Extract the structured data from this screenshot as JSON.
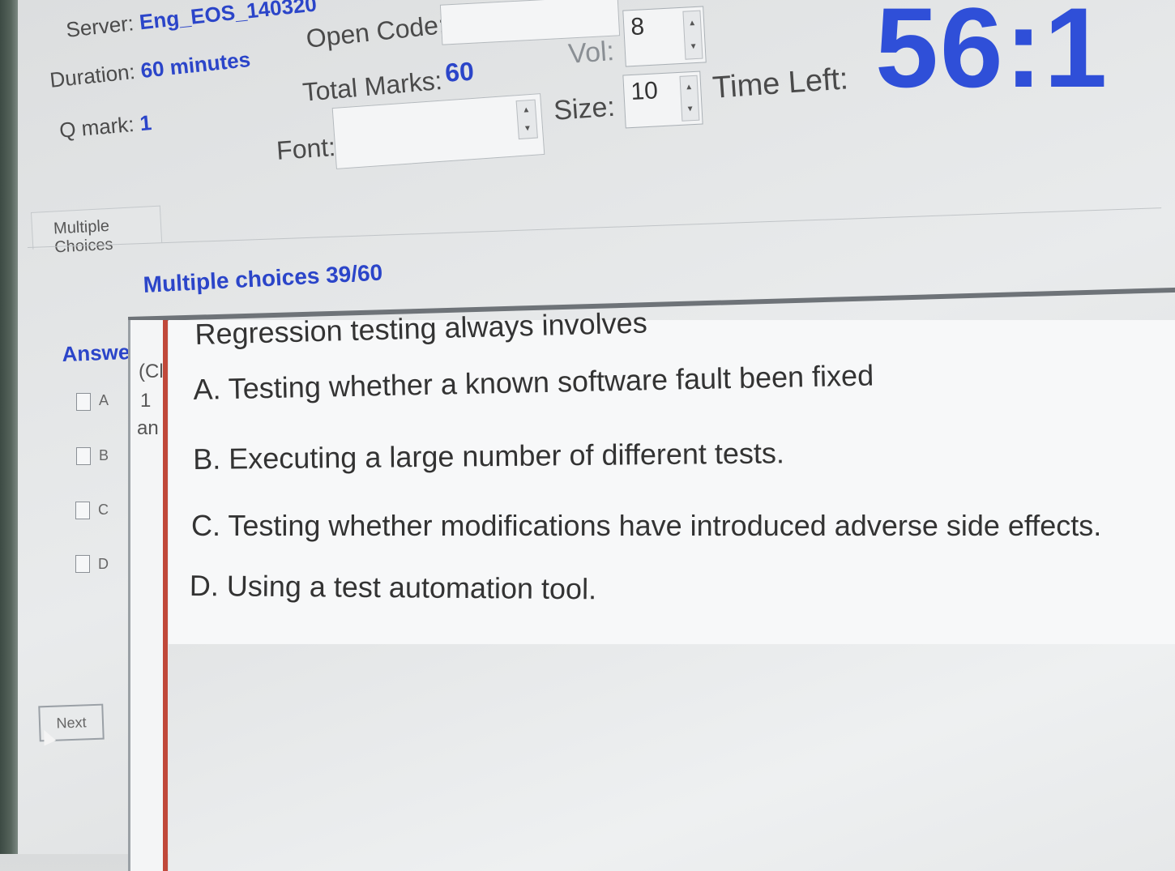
{
  "header": {
    "server_label": "Server:",
    "server_value": "Eng_EOS_140320",
    "duration_label": "Duration:",
    "duration_value": "60 minutes",
    "qmark_label": "Q mark:",
    "qmark_value": "1",
    "open_code_label": "Open Code:",
    "open_code_value": "",
    "total_marks_label": "Total Marks:",
    "total_marks_value": "60",
    "font_label": "Font:",
    "font_value": "",
    "vol_label": "Vol:",
    "vol_value": "8",
    "size_label": "Size:",
    "size_value": "10",
    "time_left_label": "Time Left:",
    "time_left_value": "56:1"
  },
  "tabs": {
    "active": "Multiple Choices"
  },
  "question": {
    "section_title": "Multiple choices 39/60",
    "answer_label": "Answer",
    "narrow_column": [
      "(Cl",
      "1",
      "an"
    ],
    "text": "Regression testing always involves",
    "options": [
      {
        "key": "A",
        "text": "A. Testing whether a known software fault been fixed"
      },
      {
        "key": "B",
        "text": "B. Executing a large number of different tests."
      },
      {
        "key": "C",
        "text": "C. Testing whether modifications have introduced adverse side effects."
      },
      {
        "key": "D",
        "text": "D. Using a test automation tool."
      }
    ]
  },
  "buttons": {
    "next": "Next"
  },
  "colors": {
    "accent_blue": "#2f4fd8",
    "label_blue": "#2b45c9",
    "divider_red": "#c0483a"
  }
}
